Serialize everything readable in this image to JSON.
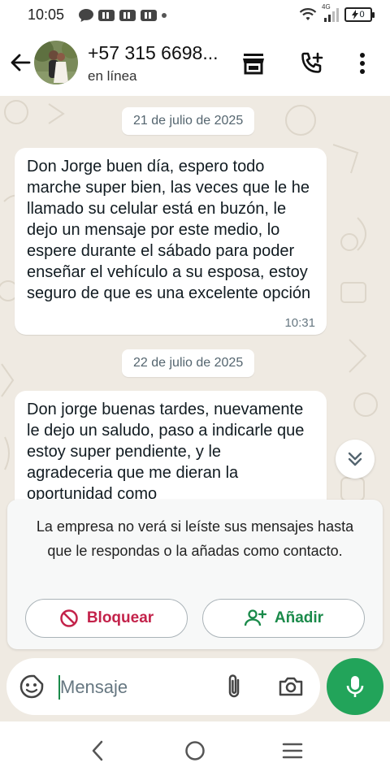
{
  "status_bar": {
    "time": "10:05",
    "network_label": "4G",
    "battery_level": "0"
  },
  "header": {
    "contact_name": "+57 315 6698...",
    "contact_status": "en línea"
  },
  "messages": [
    {
      "date": "21 de julio de 2025",
      "text": "Don Jorge buen día, espero todo marche super bien, las veces que le he llamado su celular está en buzón, le dejo un mensaje por este medio, lo espere durante el sábado para poder enseñar el vehículo a su esposa, estoy seguro de que es una excelente opción",
      "time": "10:31"
    },
    {
      "date": "22 de julio de 2025",
      "text": "Don jorge buenas tardes, nuevamente le dejo un saludo, paso a indicarle que estoy super pendiente, y le agradeceria que me dieran la oportunidad como",
      "time": ""
    }
  ],
  "notice": {
    "text": "La empresa no verá si leíste sus mensajes hasta que le respondas o la añadas como contacto.",
    "block_label": "Bloquear",
    "add_label": "Añadir"
  },
  "composer": {
    "placeholder": "Mensaje"
  },
  "colors": {
    "chat_background": "#efeae2",
    "accent_green": "#22a45a",
    "block_red": "#c3224a",
    "add_green": "#1a8a4a"
  },
  "icons": {
    "back": "arrow-left-icon",
    "store": "store-icon",
    "add_call": "phone-plus-icon",
    "menu": "more-vert-icon",
    "scroll_down": "double-chevron-down-icon",
    "emoji": "sticker-icon",
    "attach": "paperclip-icon",
    "camera": "camera-icon",
    "mic": "microphone-icon"
  }
}
